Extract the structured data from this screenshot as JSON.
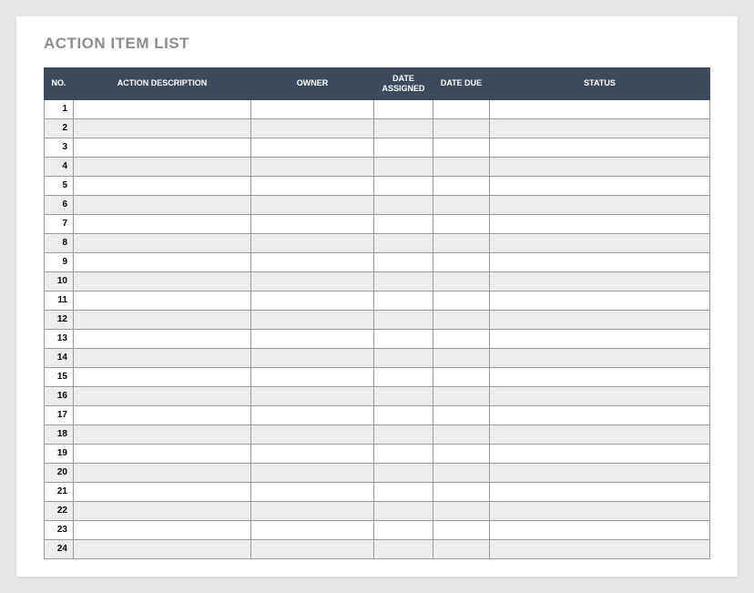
{
  "title": "ACTION ITEM LIST",
  "columns": {
    "no": "NO.",
    "description": "ACTION DESCRIPTION",
    "owner": "OWNER",
    "date_assigned": "DATE ASSIGNED",
    "date_due": "DATE DUE",
    "status": "STATUS"
  },
  "rows": [
    {
      "no": "1",
      "description": "",
      "owner": "",
      "date_assigned": "",
      "date_due": "",
      "status": ""
    },
    {
      "no": "2",
      "description": "",
      "owner": "",
      "date_assigned": "",
      "date_due": "",
      "status": ""
    },
    {
      "no": "3",
      "description": "",
      "owner": "",
      "date_assigned": "",
      "date_due": "",
      "status": ""
    },
    {
      "no": "4",
      "description": "",
      "owner": "",
      "date_assigned": "",
      "date_due": "",
      "status": ""
    },
    {
      "no": "5",
      "description": "",
      "owner": "",
      "date_assigned": "",
      "date_due": "",
      "status": ""
    },
    {
      "no": "6",
      "description": "",
      "owner": "",
      "date_assigned": "",
      "date_due": "",
      "status": ""
    },
    {
      "no": "7",
      "description": "",
      "owner": "",
      "date_assigned": "",
      "date_due": "",
      "status": ""
    },
    {
      "no": "8",
      "description": "",
      "owner": "",
      "date_assigned": "",
      "date_due": "",
      "status": ""
    },
    {
      "no": "9",
      "description": "",
      "owner": "",
      "date_assigned": "",
      "date_due": "",
      "status": ""
    },
    {
      "no": "10",
      "description": "",
      "owner": "",
      "date_assigned": "",
      "date_due": "",
      "status": ""
    },
    {
      "no": "11",
      "description": "",
      "owner": "",
      "date_assigned": "",
      "date_due": "",
      "status": ""
    },
    {
      "no": "12",
      "description": "",
      "owner": "",
      "date_assigned": "",
      "date_due": "",
      "status": ""
    },
    {
      "no": "13",
      "description": "",
      "owner": "",
      "date_assigned": "",
      "date_due": "",
      "status": ""
    },
    {
      "no": "14",
      "description": "",
      "owner": "",
      "date_assigned": "",
      "date_due": "",
      "status": ""
    },
    {
      "no": "15",
      "description": "",
      "owner": "",
      "date_assigned": "",
      "date_due": "",
      "status": ""
    },
    {
      "no": "16",
      "description": "",
      "owner": "",
      "date_assigned": "",
      "date_due": "",
      "status": ""
    },
    {
      "no": "17",
      "description": "",
      "owner": "",
      "date_assigned": "",
      "date_due": "",
      "status": ""
    },
    {
      "no": "18",
      "description": "",
      "owner": "",
      "date_assigned": "",
      "date_due": "",
      "status": ""
    },
    {
      "no": "19",
      "description": "",
      "owner": "",
      "date_assigned": "",
      "date_due": "",
      "status": ""
    },
    {
      "no": "20",
      "description": "",
      "owner": "",
      "date_assigned": "",
      "date_due": "",
      "status": ""
    },
    {
      "no": "21",
      "description": "",
      "owner": "",
      "date_assigned": "",
      "date_due": "",
      "status": ""
    },
    {
      "no": "22",
      "description": "",
      "owner": "",
      "date_assigned": "",
      "date_due": "",
      "status": ""
    },
    {
      "no": "23",
      "description": "",
      "owner": "",
      "date_assigned": "",
      "date_due": "",
      "status": ""
    },
    {
      "no": "24",
      "description": "",
      "owner": "",
      "date_assigned": "",
      "date_due": "",
      "status": ""
    }
  ]
}
